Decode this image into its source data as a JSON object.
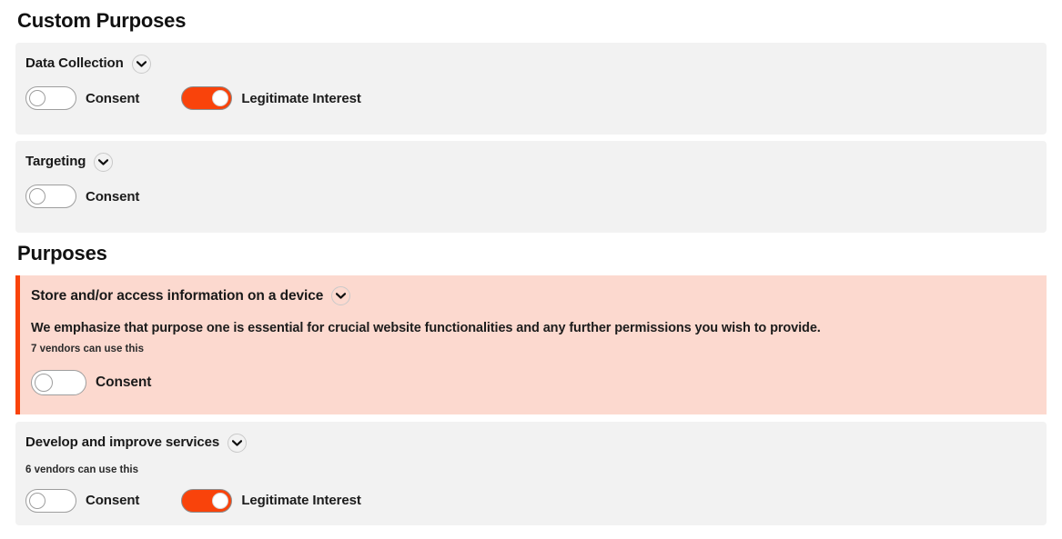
{
  "headings": {
    "custom_purposes": "Custom Purposes",
    "purposes": "Purposes"
  },
  "labels": {
    "consent": "Consent",
    "legitimate_interest": "Legitimate Interest"
  },
  "icons": {
    "expand": "chevron-down-icon"
  },
  "colors": {
    "accent": "#f9430b",
    "panel_bg": "#f2f2f2",
    "highlight_bg": "#fcd9cf",
    "page_bg": "#ffffff",
    "text": "#1a1a1a"
  },
  "custom_purposes": [
    {
      "title": "Data Collection",
      "toggles": [
        {
          "label": "Consent",
          "state": "off"
        },
        {
          "label": "Legitimate Interest",
          "state": "on"
        }
      ]
    },
    {
      "title": "Targeting",
      "toggles": [
        {
          "label": "Consent",
          "state": "off"
        }
      ]
    }
  ],
  "purposes": [
    {
      "title": "Store and/or access information on a device",
      "description": "We emphasize that purpose one is essential for crucial website functionalities and any further permissions you wish to provide.",
      "vendors": "7 vendors can use this",
      "highlighted": true,
      "toggles": [
        {
          "label": "Consent",
          "state": "off"
        }
      ]
    },
    {
      "title": "Develop and improve services",
      "description": "",
      "vendors": "6 vendors can use this",
      "highlighted": false,
      "toggles": [
        {
          "label": "Consent",
          "state": "off"
        },
        {
          "label": "Legitimate Interest",
          "state": "on"
        }
      ]
    }
  ]
}
